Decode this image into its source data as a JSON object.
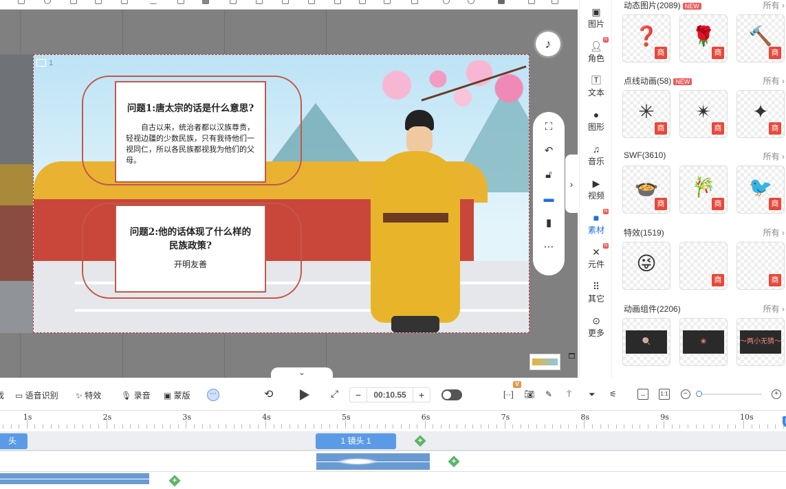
{
  "canvas": {
    "scene_number": "1",
    "card1": {
      "title": "问题1:唐太宗的话是什么意思?",
      "body": "自古以来，统治者都以汉族尊贵，轻视边疆的少数民族，只有我待他们一视同仁，所以各民族都视我为他们的父母。"
    },
    "card2": {
      "title_line1": "问题2:他的话体现了什么样的",
      "title_line2": "民族政策?",
      "answer": "开明友善"
    }
  },
  "float_toolbar": {
    "icons": [
      "fit-screen-icon",
      "rotate-icon",
      "unlock-icon",
      "screen-icon",
      "phone-icon",
      "more-icon"
    ]
  },
  "icon_sidebar": [
    {
      "label": "图片",
      "icon": "image-icon"
    },
    {
      "label": "角色",
      "icon": "person-icon",
      "badge": "N"
    },
    {
      "label": "文本",
      "icon": "text-icon"
    },
    {
      "label": "图形",
      "icon": "shape-icon"
    },
    {
      "label": "音乐",
      "icon": "music-icon"
    },
    {
      "label": "视频",
      "icon": "video-icon"
    },
    {
      "label": "素材",
      "icon": "folder-icon",
      "badge": "N",
      "active": true
    },
    {
      "label": "元件",
      "icon": "pinwheel-icon",
      "badge": "N"
    },
    {
      "label": "其它",
      "icon": "grid-icon"
    },
    {
      "label": "更多",
      "icon": "more-icon"
    }
  ],
  "library": {
    "all_label": "所有 ›",
    "commercial_badge": "商",
    "sections": [
      {
        "title": "动态图片(2089)",
        "new": "NEW",
        "items": [
          "❓",
          "🌹",
          "🔨"
        ],
        "shang": [
          true,
          true,
          true
        ]
      },
      {
        "title": "点线动画(58)",
        "new": "NEW",
        "items": [
          "✳",
          "✴",
          "✦"
        ],
        "shang": [
          true,
          true,
          true
        ]
      },
      {
        "title": "SWF(3610)",
        "items": [
          "🍲",
          "🎋",
          "🐦"
        ],
        "shang": [
          true,
          true,
          true
        ]
      },
      {
        "title": "特效(1519)",
        "items": [
          "😜",
          "",
          ""
        ],
        "shang": [
          false,
          true,
          true
        ]
      },
      {
        "title": "动画组件(2206)",
        "items": [
          "🍭",
          "❀",
          "～两小无猜～"
        ],
        "shang": [
          false,
          false,
          false
        ],
        "dark": true
      }
    ]
  },
  "timeline_toolbar": {
    "tools": [
      "戏",
      "语音识别",
      "特效",
      "录音",
      "蒙版"
    ],
    "time": "00:10.55",
    "minus": "−",
    "plus": "+",
    "vip_badge": "V",
    "ratio_label": "1:1"
  },
  "timeline": {
    "ruler_labels": [
      "1s",
      "2s",
      "3s",
      "4s",
      "5s",
      "6s",
      "7s",
      "8s",
      "9s",
      "10s"
    ],
    "playhead_seconds": 10.55,
    "zoom_level": 0.02,
    "clips": {
      "scene_prev": "头",
      "scene_current": "1 镜头 1"
    }
  },
  "colors": {
    "accent": "#1f6fe0",
    "clip": "#5b9be6",
    "playhead": "#d22",
    "add": "#5bb56a",
    "badge": "#e8483a"
  }
}
